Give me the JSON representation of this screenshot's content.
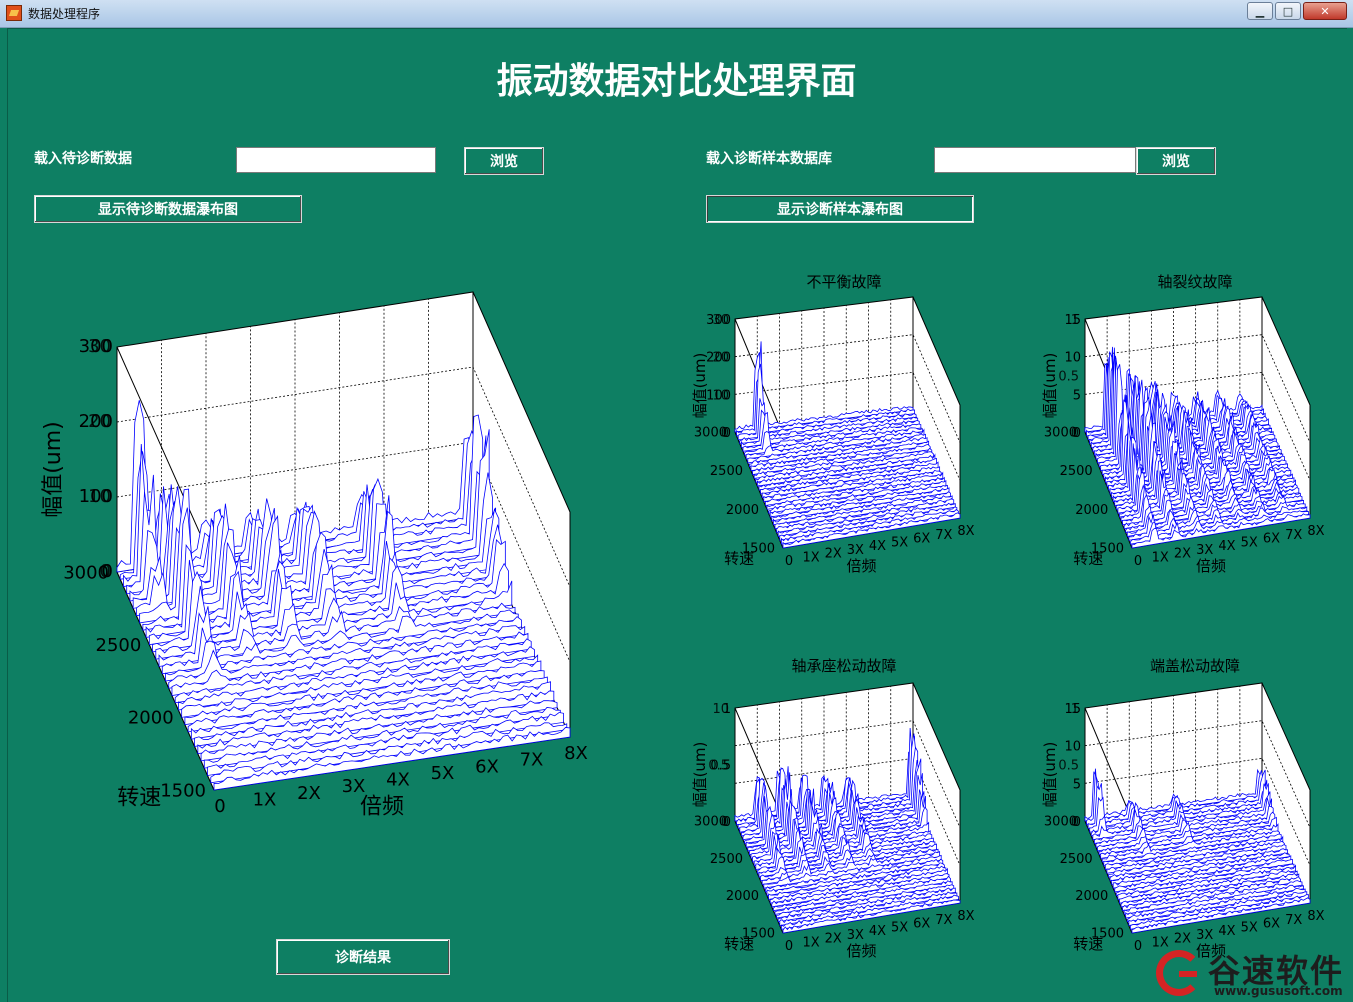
{
  "window": {
    "title": "数据处理程序",
    "min_glyph": "▁",
    "max_glyph": "□",
    "close_glyph": "✕"
  },
  "main_title": "振动数据对比处理界面",
  "left": {
    "load_label": "载入待诊断数据",
    "load_value": "",
    "browse_label": "浏览",
    "show_label": "显示待诊断数据瀑布图"
  },
  "right": {
    "load_label": "载入诊断样本数据库",
    "load_value": "",
    "browse_label": "浏览",
    "show_label": "显示诊断样本瀑布图"
  },
  "diagnose_label": "诊断结果",
  "watermark": {
    "name": "谷速软件",
    "url": "www.gususoft.com"
  },
  "colors": {
    "background": "#0e7f63",
    "series": "#0000ff"
  },
  "chart_data": [
    {
      "id": "main",
      "type": "waterfall-3d",
      "title": "",
      "xlabel": "倍频",
      "ylabel": "转速",
      "zlabel": "幅值(um)",
      "x_ticks": [
        "0",
        "1X",
        "2X",
        "3X",
        "4X",
        "5X",
        "6X",
        "7X",
        "8X"
      ],
      "y_ticks": [
        "1500",
        "2000",
        "2500",
        "3000"
      ],
      "z_ticks": [
        "0",
        "100",
        "200",
        "300"
      ],
      "z_ticks_overlap": [
        "0",
        "10",
        "20",
        "30"
      ],
      "xlim": [
        0,
        8
      ],
      "ylim": [
        1500,
        3000
      ],
      "zlim": [
        0,
        300
      ],
      "slices": 30,
      "peaks": [
        [
          0.5,
          300,
          3000,
          0.25
        ],
        [
          1,
          0.7,
          2700,
          0.4
        ],
        [
          2,
          0.5,
          2700,
          0.3
        ],
        [
          3,
          0.5,
          2700,
          0.3
        ],
        [
          4,
          0.45,
          2700,
          0.3
        ],
        [
          5.5,
          0.5,
          2700,
          0.3
        ],
        [
          7.9,
          0.7,
          2800,
          0.3
        ]
      ],
      "peak_height": 0.7
    },
    {
      "id": "unbalance",
      "type": "waterfall-3d",
      "title": "不平衡故障",
      "xlabel": "倍频",
      "ylabel": "转速",
      "zlabel": "幅值(um)",
      "x_ticks": [
        "0",
        "1X",
        "2X",
        "3X",
        "4X",
        "5X",
        "6X",
        "7X",
        "8X"
      ],
      "y_ticks": [
        "1500",
        "2000",
        "2500",
        "3000"
      ],
      "z_ticks": [
        "0",
        "100",
        "200",
        "300"
      ],
      "z_ticks_overlap": [
        "0",
        "10",
        "20",
        "30"
      ],
      "xlim": [
        0,
        8
      ],
      "ylim": [
        1500,
        3000
      ],
      "zlim": [
        0,
        300
      ],
      "slices": 30,
      "peaks": [
        [
          1,
          1,
          3000,
          0.25
        ]
      ],
      "peak_height": 0.75
    },
    {
      "id": "crack",
      "type": "waterfall-3d",
      "title": "轴裂纹故障",
      "xlabel": "倍频",
      "ylabel": "转速",
      "zlabel": "幅值(um)",
      "x_ticks": [
        "0",
        "1X",
        "2X",
        "3X",
        "4X",
        "5X",
        "6X",
        "7X",
        "8X"
      ],
      "y_ticks": [
        "1500",
        "2000",
        "2500",
        "3000"
      ],
      "z_ticks": [
        "0",
        "5",
        "10",
        "15"
      ],
      "z_ticks_overlap": [
        "0",
        "0.5",
        "1"
      ],
      "xlim": [
        0,
        8
      ],
      "ylim": [
        1500,
        3000
      ],
      "zlim": [
        0,
        15
      ],
      "slices": 30,
      "peaks": [
        [
          1,
          1,
          2700,
          0.9
        ],
        [
          2,
          0.8,
          2600,
          0.8
        ],
        [
          3,
          0.6,
          2600,
          0.8
        ],
        [
          4,
          0.4,
          2600,
          0.8
        ],
        [
          5,
          0.35,
          2600,
          0.8
        ],
        [
          6,
          0.3,
          2600,
          0.8
        ],
        [
          7,
          0.25,
          2600,
          0.8
        ]
      ],
      "peak_height": 0.75
    },
    {
      "id": "bearing",
      "type": "waterfall-3d",
      "title": "轴承座松动故障",
      "xlabel": "倍频",
      "ylabel": "转速",
      "zlabel": "幅值(um)",
      "x_ticks": [
        "0",
        "1X",
        "2X",
        "3X",
        "4X",
        "5X",
        "6X",
        "7X",
        "8X"
      ],
      "y_ticks": [
        "1500",
        "2000",
        "2500",
        "3000"
      ],
      "z_ticks": [
        "0",
        "0.5",
        "1"
      ],
      "z_ticks_overlap": [
        "0",
        "0.5",
        "10"
      ],
      "xlim": [
        0,
        8
      ],
      "ylim": [
        1500,
        3000
      ],
      "zlim": [
        0,
        1
      ],
      "slices": 30,
      "peaks": [
        [
          1,
          0.5,
          2800,
          0.5
        ],
        [
          2,
          0.6,
          2800,
          0.5
        ],
        [
          3,
          0.45,
          2800,
          0.5
        ],
        [
          4,
          0.4,
          2800,
          0.5
        ],
        [
          5,
          0.35,
          2800,
          0.5
        ],
        [
          7.9,
          0.8,
          2900,
          0.3
        ]
      ],
      "peak_height": 0.75
    },
    {
      "id": "endcover",
      "type": "waterfall-3d",
      "title": "端盖松动故障",
      "xlabel": "倍频",
      "ylabel": "转速",
      "zlabel": "幅值(um)",
      "x_ticks": [
        "0",
        "1X",
        "2X",
        "3X",
        "4X",
        "5X",
        "6X",
        "7X",
        "8X"
      ],
      "y_ticks": [
        "1500",
        "2000",
        "2500",
        "3000"
      ],
      "z_ticks": [
        "0",
        "5",
        "10",
        "15"
      ],
      "z_ticks_overlap": [
        "0",
        "0.5",
        "1"
      ],
      "xlim": [
        0,
        8
      ],
      "ylim": [
        1500,
        3000
      ],
      "zlim": [
        0,
        15
      ],
      "slices": 30,
      "peaks": [
        [
          0.5,
          0.6,
          3000,
          0.2
        ],
        [
          2,
          0.25,
          2800,
          0.3
        ],
        [
          4,
          0.2,
          2800,
          0.3
        ],
        [
          7.9,
          0.3,
          2900,
          0.3
        ]
      ],
      "peak_height": 0.75
    }
  ]
}
